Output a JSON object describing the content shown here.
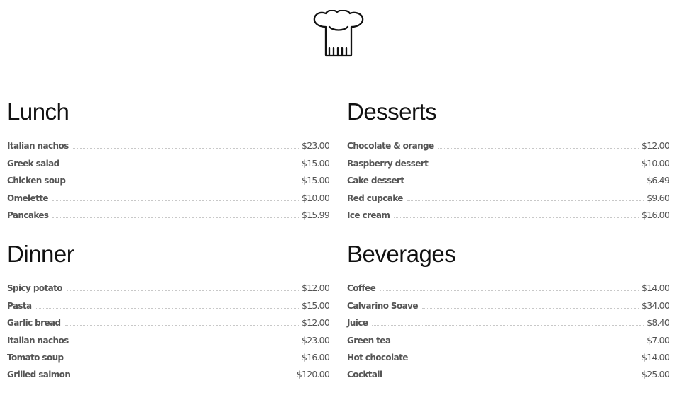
{
  "logo": {
    "icon": "chef-hat-icon"
  },
  "sections": {
    "lunch": {
      "title": "Lunch",
      "items": [
        {
          "name": "Italian nachos",
          "price": "$23.00"
        },
        {
          "name": "Greek salad",
          "price": "$15.00"
        },
        {
          "name": "Chicken soup",
          "price": "$15.00"
        },
        {
          "name": "Omelette",
          "price": "$10.00"
        },
        {
          "name": "Pancakes",
          "price": "$15.99"
        }
      ]
    },
    "desserts": {
      "title": "Desserts",
      "items": [
        {
          "name": "Chocolate & orange",
          "price": "$12.00"
        },
        {
          "name": "Raspberry dessert",
          "price": "$10.00"
        },
        {
          "name": "Cake dessert",
          "price": "$6.49"
        },
        {
          "name": "Red cupcake",
          "price": "$9.60"
        },
        {
          "name": "Ice cream",
          "price": "$16.00"
        }
      ]
    },
    "dinner": {
      "title": "Dinner",
      "items": [
        {
          "name": "Spicy potato",
          "price": "$12.00"
        },
        {
          "name": "Pasta",
          "price": "$15.00"
        },
        {
          "name": "Garlic bread",
          "price": "$12.00"
        },
        {
          "name": "Italian nachos",
          "price": "$23.00"
        },
        {
          "name": "Tomato soup",
          "price": "$16.00"
        },
        {
          "name": "Grilled salmon",
          "price": "$120.00"
        }
      ]
    },
    "beverages": {
      "title": "Beverages",
      "items": [
        {
          "name": "Coffee",
          "price": "$14.00"
        },
        {
          "name": "Calvarino Soave",
          "price": "$34.00"
        },
        {
          "name": "Juice",
          "price": "$8.40"
        },
        {
          "name": "Green tea",
          "price": "$7.00"
        },
        {
          "name": "Hot chocolate",
          "price": "$14.00"
        },
        {
          "name": "Cocktail",
          "price": "$25.00"
        }
      ]
    }
  }
}
